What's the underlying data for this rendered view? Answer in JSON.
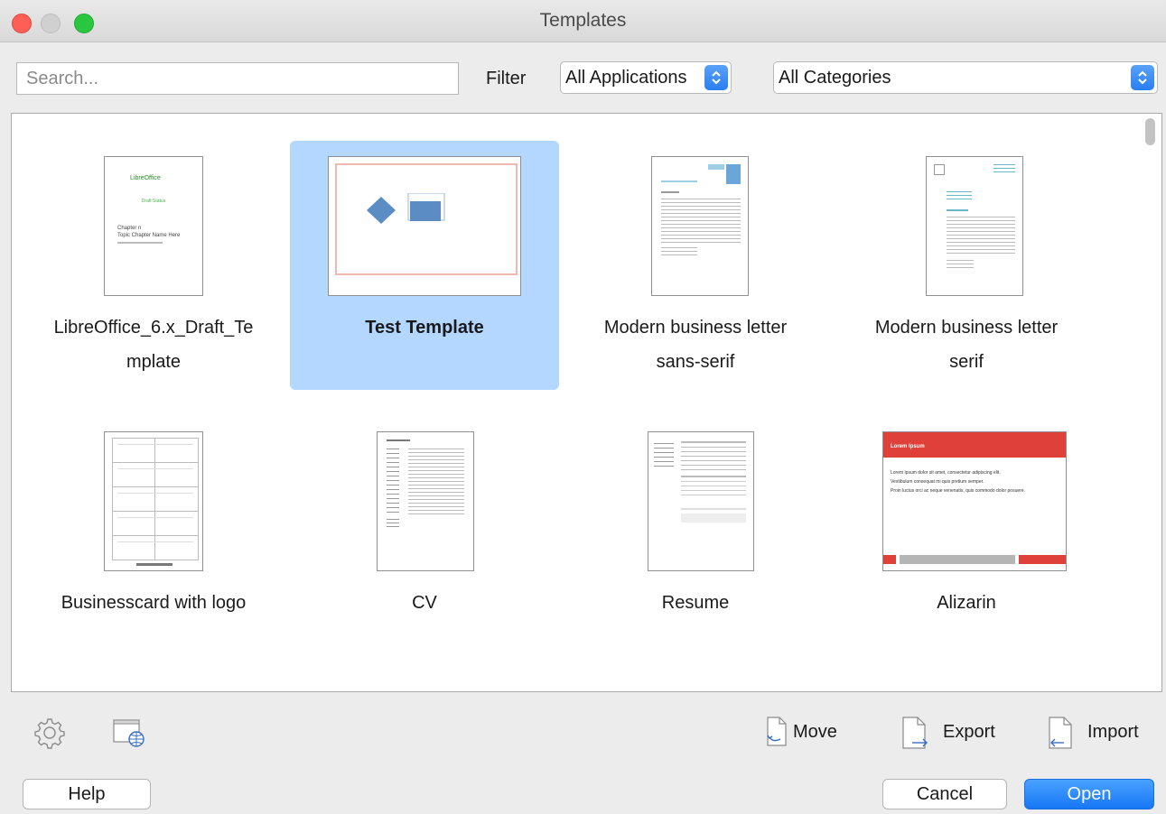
{
  "window": {
    "title": "Templates"
  },
  "toolbar": {
    "search_placeholder": "Search...",
    "filter_label": "Filter",
    "application_filter": "All Applications",
    "category_filter": "All Categories"
  },
  "templates": [
    {
      "name": "LibreOffice_6.x_Draft_Te",
      "name_line2": "mplate",
      "thumbnail": "document"
    },
    {
      "name": "Test Template",
      "name_line2": "",
      "thumbnail": "presentation",
      "selected": true
    },
    {
      "name": "Modern business letter",
      "name_line2": "sans-serif",
      "thumbnail": "letter"
    },
    {
      "name": "Modern business letter",
      "name_line2": "serif",
      "thumbnail": "letter"
    },
    {
      "name": "Businesscard with logo",
      "name_line2": "",
      "thumbnail": "business-cards"
    },
    {
      "name": "CV",
      "name_line2": "",
      "thumbnail": "cv"
    },
    {
      "name": "Resume",
      "name_line2": "",
      "thumbnail": "resume"
    },
    {
      "name": "Alizarin",
      "name_line2": "",
      "thumbnail": "presentation"
    }
  ],
  "thumbnail_text": {
    "libreoffice_logo": "LibreOffice",
    "draft_subtitle": "Draft Status",
    "chapter": "Chapter n",
    "chapter_name": "Topic Chapter Name Here",
    "alizarin_title": "Lorem Ipsum",
    "alizarin_lines": [
      "Lorem ipsum dolor sit amet, consectetur adipiscing elit.",
      "Vestibulum consequat mi quis pretium semper.",
      "Proin luctus orci ac neque venenatis, quis commodo dolor posuere."
    ]
  },
  "actions": {
    "move": "Move",
    "export": "Export",
    "import": "Import"
  },
  "buttons": {
    "help": "Help",
    "cancel": "Cancel",
    "open": "Open"
  },
  "colors": {
    "selection": "#b3d7ff",
    "primary_button": "#1677f5",
    "alizarin_red": "#e0403a"
  }
}
